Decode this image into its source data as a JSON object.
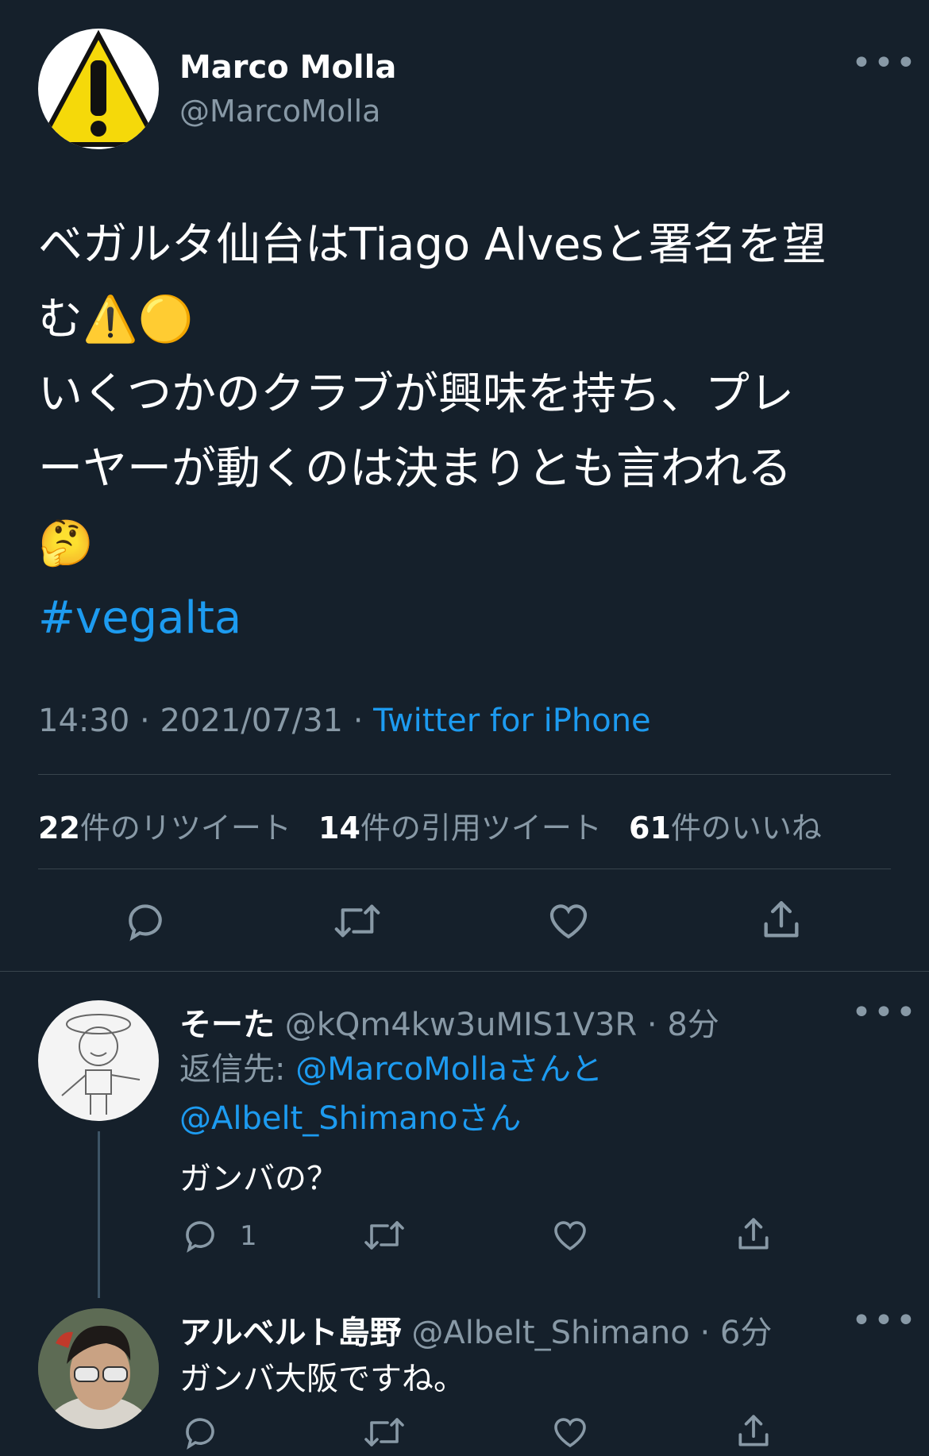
{
  "main_tweet": {
    "author_name": "Marco Molla",
    "author_handle": "@MarcoMolla",
    "text_line1": "ベガルタ仙台はTiago Alvesと署名を望",
    "text_line2": "む⚠️🟡",
    "text_line3": "いくつかのクラブが興味を持ち、プレ",
    "text_line4": "ーヤーが動くのは決まりとも言われる",
    "text_line5": "🤔",
    "hashtag": "#vegalta",
    "time": "14:30",
    "date": "2021/07/31",
    "source": "Twitter for iPhone",
    "retweets_count": "22",
    "retweets_label": "件のリツイート",
    "quotes_count": "14",
    "quotes_label": "件の引用ツイート",
    "likes_count": "61",
    "likes_label": "件のいいね"
  },
  "replies": [
    {
      "author_name": "そーた",
      "author_handle": "@kQm4kw3uMIS1V3R",
      "time_ago": "8分",
      "replying_prefix": "返信先: ",
      "replying_user1": "@MarcoMollaさんと",
      "replying_user2": "@Albelt_Shimanoさん",
      "text": "ガンバの？",
      "reply_count": "1"
    },
    {
      "author_name": "アルベルト島野",
      "author_handle": "@Albelt_Shimano",
      "time_ago": "6分",
      "text": "ガンバ大阪ですね。"
    }
  ],
  "colors": {
    "background": "#15202b",
    "link": "#1d9bf0",
    "muted": "#8899a6",
    "divider": "#38444d"
  }
}
